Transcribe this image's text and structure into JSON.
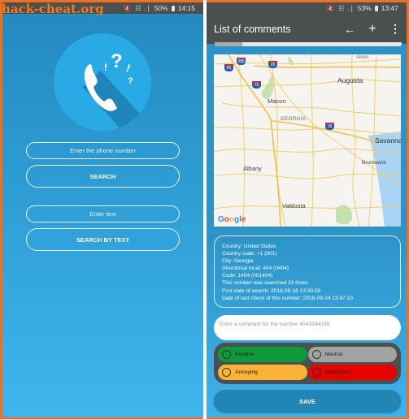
{
  "watermark": "hack-cheat.org",
  "left_screen": {
    "statusbar": {
      "icons": "🔇 ☷ .∣",
      "battery": "50%",
      "battery_icon": "battery-icon",
      "time": "14:15"
    },
    "logo_icon": "phone-question-icon",
    "phone_input": {
      "placeholder": "Enter the phone number",
      "value": ""
    },
    "search_button": "SEARCH",
    "text_input": {
      "placeholder": "Enter text",
      "value": ""
    },
    "search_by_text_button": "SEARCH BY TEXT"
  },
  "right_screen": {
    "statusbar": {
      "icons": "🔇 ☷ .∣",
      "battery": "53%",
      "battery_icon": "battery-icon",
      "time": "13:47"
    },
    "appbar": {
      "title": "List of comments",
      "actions": [
        {
          "icon": "arrow-left-icon",
          "glyph": "←"
        },
        {
          "icon": "plus-icon",
          "glyph": "+"
        },
        {
          "icon": "more-vert-icon",
          "glyph": "⋮"
        }
      ]
    },
    "map": {
      "labels": {
        "augusta": "Augusta",
        "aiken": "Aiken",
        "macon": "Macon",
        "georgia": "GEORGIA",
        "savannah": "Savannah",
        "albany": "Albany",
        "brunswick": "Brunswick",
        "valdosta": "Valdosta"
      },
      "shields": {
        "i285": "285",
        "i85": "85",
        "i20": "20",
        "i75": "75",
        "i16": "16"
      },
      "attribution": "Google"
    },
    "info_lines": [
      "Country: United States",
      "Country code: +1 (001)",
      "City: Georgia",
      "Directional local: 404 (0404)",
      "Code: 1404 (001404)",
      "This number was searched 23 times",
      "First date of search: 2018-05-16 13:33:59",
      "Date of last check of this number: 2018-09-24 13:47:10"
    ],
    "comment_input": {
      "placeholder": "Enter a comment for the number 4043344159",
      "value": ""
    },
    "ratings": [
      {
        "label": "Positive",
        "color": "#0e9a3a",
        "selected": false
      },
      {
        "label": "Neutral",
        "color": "#a3a3a3",
        "selected": false
      },
      {
        "label": "Annoying",
        "color": "#fbb236",
        "selected": false
      },
      {
        "label": "Dangerous",
        "color": "#eb0000",
        "selected": false
      }
    ],
    "save_button": "SAVE"
  },
  "colors": {
    "frame": "#f26f1d",
    "toolbar": "#4a4f50",
    "accent_blue": "#2185b6"
  }
}
